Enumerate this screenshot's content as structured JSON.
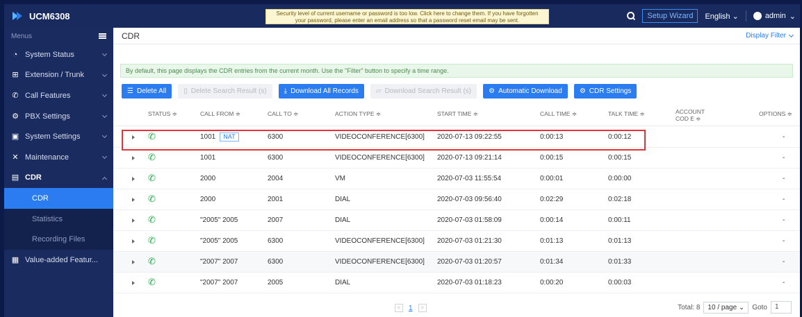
{
  "app": {
    "title": "UCM6308"
  },
  "header": {
    "warning": "Security level of current username or password is too low. Click here to change them. If you have forgotten your password, please enter an email address so that a password reset email may be sent.",
    "setup_wizard": "Setup Wizard",
    "language": "English",
    "user": "admin"
  },
  "sidebar": {
    "menus_label": "Menus",
    "items": [
      {
        "label": "System Status",
        "icon": "gauge-icon"
      },
      {
        "label": "Extension / Trunk",
        "icon": "network-icon"
      },
      {
        "label": "Call Features",
        "icon": "phone-icon"
      },
      {
        "label": "PBX Settings",
        "icon": "gear-icon"
      },
      {
        "label": "System Settings",
        "icon": "settings-icon"
      },
      {
        "label": "Maintenance",
        "icon": "tools-icon"
      },
      {
        "label": "CDR",
        "icon": "document-icon"
      }
    ],
    "sub_items": [
      "CDR",
      "Statistics",
      "Recording Files"
    ],
    "value_added": "Value-added Featur..."
  },
  "main": {
    "title": "CDR",
    "display_filter": "Display Filter",
    "info": "By default, this page displays the CDR entries from the current month. Use the \"Filter\" button to specify a time range.",
    "buttons": {
      "delete_all": "Delete All",
      "delete_search": "Delete Search Result (s)",
      "download_all": "Download All Records",
      "download_search": "Download Search Result (s)",
      "auto_download": "Automatic Download",
      "cdr_settings": "CDR Settings"
    },
    "columns": {
      "status": "STATUS ≑",
      "call_from": "CALL FROM ≑",
      "call_to": "CALL TO ≑",
      "action_type": "ACTION TYPE ≑",
      "start_time": "START TIME ≑",
      "call_time": "CALL TIME ≑",
      "talk_time": "TALK TIME ≑",
      "account_code": "ACCOUNT COD E ≑",
      "options": "OPTIONS ≑"
    },
    "nat_badge": "NAT",
    "rows": [
      {
        "from": "1001",
        "to": "6300",
        "action": "VIDEOCONFERENCE[6300]",
        "start": "2020-07-13 09:22:55",
        "call": "0:00:13",
        "talk": "0:00:12",
        "opt": "-"
      },
      {
        "from": "1001",
        "to": "6300",
        "action": "VIDEOCONFERENCE[6300]",
        "start": "2020-07-13 09:21:14",
        "call": "0:00:15",
        "talk": "0:00:15",
        "opt": "-"
      },
      {
        "from": "2000",
        "to": "2004",
        "action": "VM",
        "start": "2020-07-03 11:55:54",
        "call": "0:00:01",
        "talk": "0:00:00",
        "opt": "-"
      },
      {
        "from": "2000",
        "to": "2001",
        "action": "DIAL",
        "start": "2020-07-03 09:56:40",
        "call": "0:02:29",
        "talk": "0:02:18",
        "opt": "-"
      },
      {
        "from": "\"2005\" 2005",
        "to": "2007",
        "action": "DIAL",
        "start": "2020-07-03 01:58:09",
        "call": "0:00:14",
        "talk": "0:00:11",
        "opt": "-"
      },
      {
        "from": "\"2005\" 2005",
        "to": "6300",
        "action": "VIDEOCONFERENCE[6300]",
        "start": "2020-07-03 01:21:30",
        "call": "0:01:13",
        "talk": "0:01:13",
        "opt": "-"
      },
      {
        "from": "\"2007\" 2007",
        "to": "6300",
        "action": "VIDEOCONFERENCE[6300]",
        "start": "2020-07-03 01:20:57",
        "call": "0:01:34",
        "talk": "0:01:33",
        "opt": "-"
      },
      {
        "from": "\"2007\" 2007",
        "to": "2005",
        "action": "DIAL",
        "start": "2020-07-03 01:18:23",
        "call": "0:00:20",
        "talk": "0:00:03",
        "opt": "-"
      }
    ],
    "pagination": {
      "prev": "<",
      "page": "1",
      "next": ">",
      "total": "Total: 8",
      "per_page": "10 / page",
      "goto_label": "Goto",
      "goto_value": "1"
    }
  },
  "colors": {
    "accent": "#2b7cf0",
    "sidebar": "#1a2b5f",
    "highlight": "#e3333a",
    "status": "#2aa84a"
  }
}
